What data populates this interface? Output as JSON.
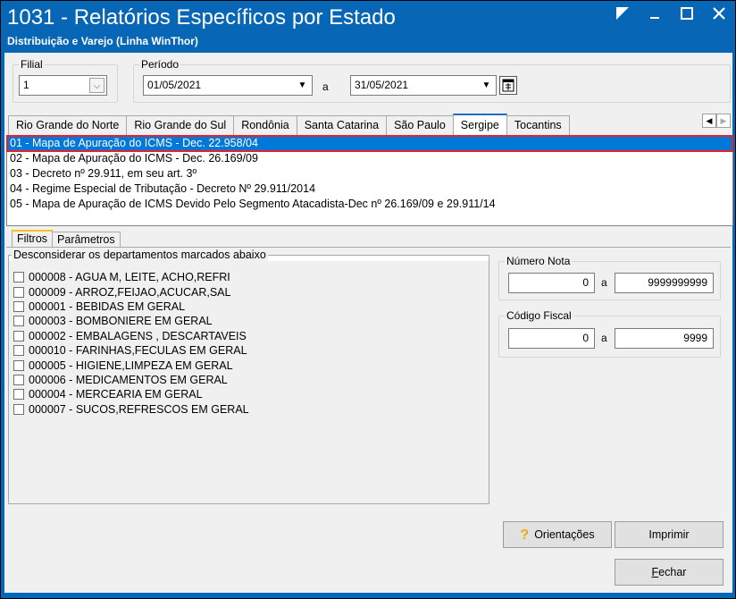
{
  "window": {
    "title": "1031 - Relatórios Específicos por Estado",
    "subtitle": "Distribuição e Varejo (Linha WinThor)",
    "buttons": [
      "restore-icon",
      "minimize-icon",
      "maximize-icon",
      "close-icon"
    ]
  },
  "filial": {
    "label": "Filial",
    "value": "1"
  },
  "periodo": {
    "label": "Período",
    "start": "01/05/2021",
    "separator": "a",
    "end": "31/05/2021"
  },
  "state_tabs": [
    {
      "label": "Rio Grande do Norte"
    },
    {
      "label": "Rio Grande do Sul"
    },
    {
      "label": "Rondônia"
    },
    {
      "label": "Santa Catarina"
    },
    {
      "label": "São Paulo"
    },
    {
      "label": "Sergipe",
      "active": true
    },
    {
      "label": "Tocantins"
    }
  ],
  "reports": [
    "01 - Mapa de Apuração do ICMS - Dec. 22.958/04",
    "02 - Mapa de Apuração do ICMS - Dec. 26.169/09",
    "03 - Decreto nº 29.911, em seu art. 3º",
    "04 - Regime Especial de Tributação - Decreto Nº 29.911/2014",
    "05 - Mapa de Apuração de ICMS Devido Pelo Segmento Atacadista-Dec nº 26.169/09 e 29.911/14"
  ],
  "sub_tabs": [
    "Filtros",
    "Parâmetros"
  ],
  "departments": {
    "label": "Desconsiderar os departamentos marcados abaixo",
    "items": [
      "000008 - AGUA M, LEITE, ACHO,REFRI",
      "000009 - ARROZ,FEIJAO,ACUCAR,SAL",
      "000001 - BEBIDAS EM GERAL",
      "000003 - BOMBONIERE EM GERAL",
      "000002 - EMBALAGENS , DESCARTAVEIS",
      "000010 - FARINHAS,FECULAS EM GERAL",
      "000005 - HIGIENE,LIMPEZA EM GERAL",
      "000006 - MEDICAMENTOS EM GERAL",
      "000004 - MERCEARIA EM GERAL",
      "000007 - SUCOS,REFRESCOS EM GERAL"
    ]
  },
  "numero_nota": {
    "label": "Número Nota",
    "from": "0",
    "separator": "a",
    "to": "9999999999"
  },
  "codigo_fiscal": {
    "label": "Código Fiscal",
    "from": "0",
    "separator": "a",
    "to": "9999"
  },
  "buttons": {
    "orientacoes": "Orientações",
    "imprimir": "Imprimir",
    "fechar_first": "F",
    "fechar_rest": "echar"
  },
  "colors": {
    "title_bar": "#0767b6",
    "selection": "#0078d7",
    "highlight_border": "#e6202d"
  }
}
